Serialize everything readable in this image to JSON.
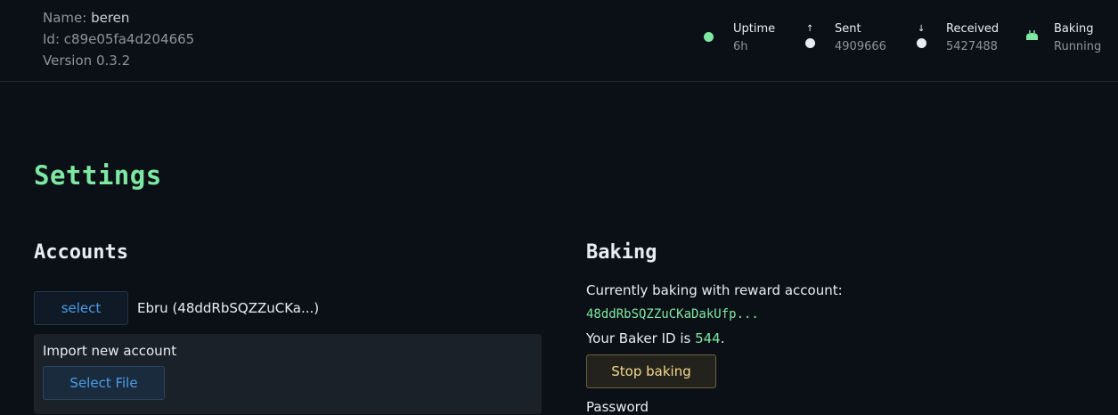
{
  "node": {
    "name_label": "Name:",
    "name": "beren",
    "id_label": "Id:",
    "id": "c89e05fa4d204665",
    "version_label": "Version",
    "version": "0.3.2"
  },
  "stats": {
    "uptime": {
      "title": "Uptime",
      "value": "6h",
      "color": "#7ee8a2"
    },
    "sent": {
      "title": "Sent",
      "value": "4909666"
    },
    "received": {
      "title": "Received",
      "value": "5427488"
    },
    "baking": {
      "title": "Baking",
      "value": "Running",
      "icon": "bread-icon",
      "color": "#7ee8a2"
    }
  },
  "page": {
    "title": "Settings"
  },
  "accounts": {
    "title": "Accounts",
    "select_label": "select",
    "current_account": "Ebru (48ddRbSQZZuCKa...)",
    "import_label": "Import new account",
    "select_file_label": "Select File"
  },
  "baking": {
    "title": "Baking",
    "currently_label": "Currently baking with reward account:",
    "reward_account": "48ddRbSQZZuCKaDakUfp...",
    "baker_id_prefix": "Your Baker ID is",
    "baker_id": "544",
    "baker_id_suffix": ".",
    "stop_label": "Stop baking",
    "next_label": "Password"
  }
}
